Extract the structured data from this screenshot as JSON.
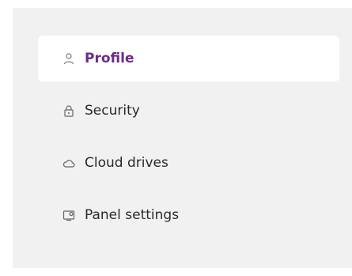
{
  "sidebar": {
    "items": [
      {
        "label": "Profile",
        "icon": "user-icon",
        "active": true
      },
      {
        "label": "Security",
        "icon": "lock-icon",
        "active": false
      },
      {
        "label": "Cloud drives",
        "icon": "cloud-icon",
        "active": false
      },
      {
        "label": "Panel settings",
        "icon": "panel-settings-icon",
        "active": false
      }
    ]
  },
  "colors": {
    "panel_background": "#f1f1f1",
    "active_background": "#ffffff",
    "active_text": "#6a2c85",
    "text": "#2a2a2a"
  }
}
